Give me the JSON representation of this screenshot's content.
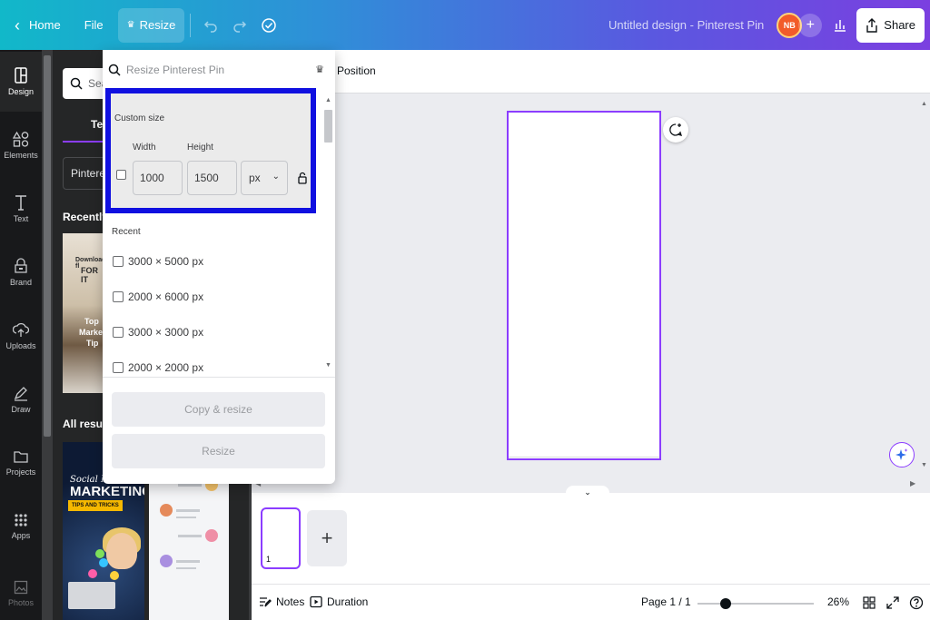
{
  "topbar": {
    "home_label": "Home",
    "file_label": "File",
    "resize_label": "Resize",
    "doc_title": "Untitled design - Pinterest Pin",
    "avatar_initials": "NB",
    "share_label": "Share"
  },
  "leftnav": {
    "items": [
      {
        "label": "Design",
        "icon": "design-icon"
      },
      {
        "label": "Elements",
        "icon": "elements-icon"
      },
      {
        "label": "Text",
        "icon": "text-icon"
      },
      {
        "label": "Brand",
        "icon": "brand-icon"
      },
      {
        "label": "Uploads",
        "icon": "upload-icon"
      },
      {
        "label": "Draw",
        "icon": "pen-icon"
      },
      {
        "label": "Projects",
        "icon": "folder-icon"
      },
      {
        "label": "Apps",
        "icon": "grid-icon"
      },
      {
        "label": "Photos",
        "icon": "image-icon"
      }
    ]
  },
  "sidepanel": {
    "search_placeholder": "Sear",
    "tab_label": "Te",
    "dropdown_label": "Pinteres",
    "recent_heading": "Recently u",
    "all_results_heading": "All results",
    "recent_thumb": {
      "line1": "Download fl",
      "line2": "FOR IT",
      "line3": "Top",
      "line4": "Marke",
      "line5": "Tip"
    },
    "marketing_thumb": {
      "line1": "Social Me",
      "line2": "MARKETING",
      "line3": "TIPS AND TRICKS"
    }
  },
  "resize_panel": {
    "search_placeholder": "Resize Pinterest Pin",
    "custom_size_label": "Custom size",
    "width_label": "Width",
    "height_label": "Height",
    "width_value": "1000",
    "height_value": "1500",
    "unit": "px",
    "recent_label": "Recent",
    "recent_items": [
      "3000 × 5000 px",
      "2000 × 6000 px",
      "3000 × 3000 px",
      "2000 × 2000 px"
    ],
    "copy_resize_label": "Copy & resize",
    "resize_label": "Resize"
  },
  "canvas": {
    "context_position_label": "Position"
  },
  "pages": {
    "thumb_number": "1"
  },
  "footer": {
    "notes_label": "Notes",
    "duration_label": "Duration",
    "page_indicator": "Page 1 / 1",
    "zoom_label": "26%",
    "zoom_level": 0.24
  },
  "colors": {
    "accent": "#8b3dff",
    "highlight_border": "#1010e0"
  }
}
